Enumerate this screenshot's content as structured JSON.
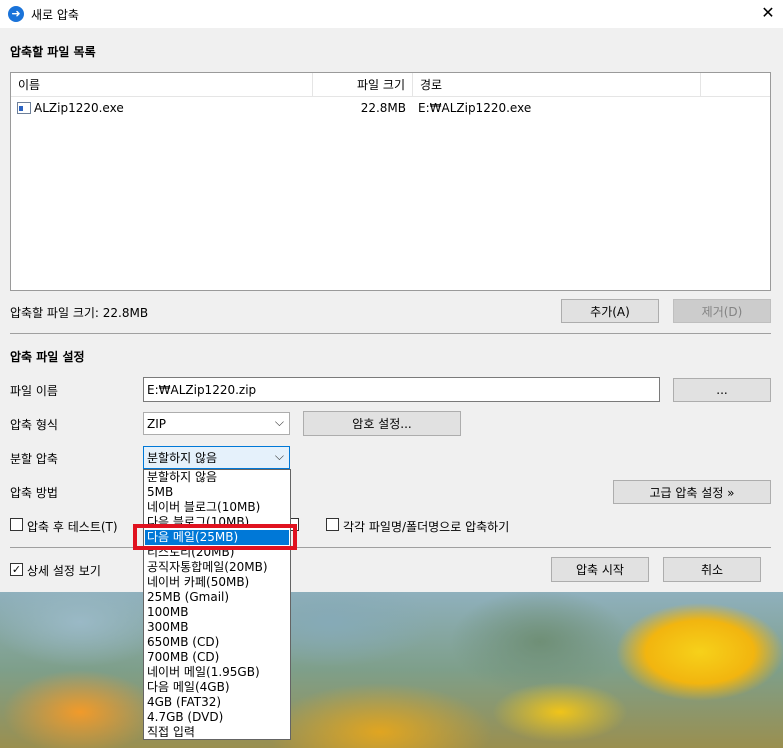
{
  "window": {
    "title": "새로 압축",
    "close_glyph": "✕",
    "icon_glyph": "➜"
  },
  "file_list": {
    "section_title": "압축할 파일 목록",
    "columns": [
      "이름",
      "파일 크기",
      "경로"
    ],
    "rows": [
      {
        "name": "ALZip1220.exe",
        "size": "22.8MB",
        "path": "E:₩ALZip1220.exe"
      }
    ],
    "total_size_label": "압축할 파일 크기: 22.8MB",
    "add_button": "추가(A)",
    "remove_button": "제거(D)"
  },
  "settings": {
    "section_title": "압축 파일 설정",
    "filename_label": "파일 이름",
    "filename_value": "E:₩ALZip1220.zip",
    "browse_button": "...",
    "format_label": "압축 형식",
    "format_value": "ZIP",
    "password_button": "암호 설정...",
    "split_label": "분할 압축",
    "split_value": "분할하지 않음",
    "method_label": "압축 방법",
    "advanced_button": "고급 압축 설정 »",
    "test_after_label": "압축 후 테스트(T)",
    "each_file_label": "각각 파일명/폴더명으로 압축하기",
    "detail_view_label": "상세 설정 보기",
    "start_button": "압축 시작",
    "cancel_button": "취소"
  },
  "split_options": [
    "분할하지 않음",
    "5MB",
    "네이버 블로그(10MB)",
    "다음 블로그(10MB)",
    "다음 메일(25MB)",
    "티스토리(20MB)",
    "공직자통합메일(20MB)",
    "네이버 카페(50MB)",
    "25MB (Gmail)",
    "100MB",
    "300MB",
    "650MB (CD)",
    "700MB (CD)",
    "네이버 메일(1.95GB)",
    "다음 메일(4GB)",
    "4GB (FAT32)",
    "4.7GB (DVD)",
    "직접 입력"
  ],
  "split_selected_index": 4,
  "colors": {
    "selection": "#0078d7",
    "highlight": "#e0121f"
  }
}
